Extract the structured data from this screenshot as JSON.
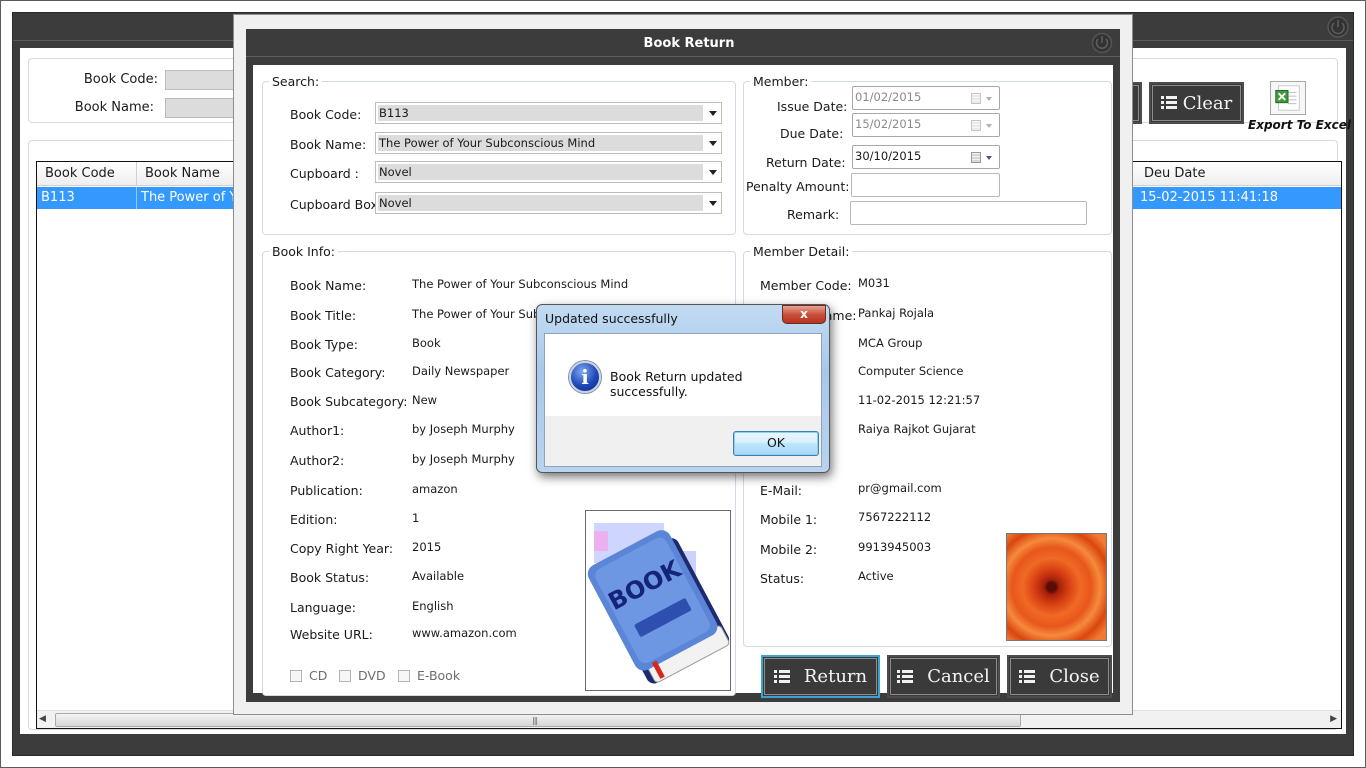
{
  "main_window": {
    "search": {
      "book_code_label": "Book Code:",
      "book_code_value": "",
      "book_name_label": "Book Name:",
      "book_name_value": ""
    },
    "clear_button": "Clear",
    "export_label": "Export To Excel",
    "grid": {
      "columns": [
        "Book Code",
        "Book Name",
        "Deu Date"
      ],
      "rows": [
        {
          "book_code": "B113",
          "book_name": "The Power of Yo",
          "due_date": "15-02-2015 11:41:18",
          "selected": true
        }
      ]
    }
  },
  "book_return": {
    "title": "Book Return",
    "search": {
      "legend": "Search:",
      "book_code_label": "Book Code:",
      "book_code": "B113",
      "book_name_label": "Book Name:",
      "book_name": "The Power of Your Subconscious Mind",
      "cupboard_label": "Cupboard :",
      "cupboard": "Novel",
      "cupboard_box_label": "Cupboard Box:",
      "cupboard_box": "Novel"
    },
    "member": {
      "legend": "Member:",
      "issue_date_label": "Issue Date:",
      "issue_date": "01/02/2015",
      "due_date_label": "Due Date:",
      "due_date": "15/02/2015",
      "return_date_label": "Return Date:",
      "return_date": "30/10/2015",
      "penalty_label": "Penalty Amount:",
      "penalty": "",
      "remark_label": "Remark:",
      "remark": ""
    },
    "book_info": {
      "legend": "Book Info:",
      "fields": [
        {
          "label": "Book Name:",
          "value": "The Power of Your Subconscious Mind"
        },
        {
          "label": "Book Title:",
          "value": "The Power of Your Subconscious Mind"
        },
        {
          "label": "Book Type:",
          "value": "Book"
        },
        {
          "label": "Book Category:",
          "value": "Daily Newspaper"
        },
        {
          "label": "Book Subcategory:",
          "value": "New"
        },
        {
          "label": "Author1:",
          "value": "by Joseph Murphy"
        },
        {
          "label": "Author2:",
          "value": "by Joseph Murphy"
        },
        {
          "label": "Publication:",
          "value": "amazon"
        },
        {
          "label": "Edition:",
          "value": "1"
        },
        {
          "label": "Copy Right Year:",
          "value": "2015"
        },
        {
          "label": "Book Status:",
          "value": "Available"
        },
        {
          "label": "Language:",
          "value": "English"
        },
        {
          "label": "Website URL:",
          "value": "www.amazon.com"
        }
      ],
      "media": [
        {
          "label": "CD",
          "checked": false
        },
        {
          "label": "DVD",
          "checked": false
        },
        {
          "label": "E-Book",
          "checked": false
        }
      ],
      "cover_text": "BOOK"
    },
    "member_detail": {
      "legend": "Member Detail:",
      "fields": [
        {
          "label": "Member Code:",
          "value": "M031"
        },
        {
          "label": "Member Name:",
          "value": "Pankaj Rojala"
        },
        {
          "label": "",
          "value": "MCA Group"
        },
        {
          "label": "",
          "value": "Computer Science"
        },
        {
          "label": "",
          "value": "11-02-2015 12:21:57"
        },
        {
          "label": "",
          "value": "Raiya Rajkot Gujarat"
        },
        {
          "label": "E-Mail:",
          "value": "pr@gmail.com"
        },
        {
          "label": "Mobile 1:",
          "value": "7567222112"
        },
        {
          "label": "Mobile 2:",
          "value": "9913945003"
        },
        {
          "label": "Status:",
          "value": "Active"
        }
      ]
    },
    "buttons": {
      "return": "Return",
      "cancel": "Cancel",
      "close": "Close"
    }
  },
  "message_box": {
    "title": "Updated successfully",
    "message": "Book Return updated successfully.",
    "ok": "OK",
    "close_glyph": "x"
  }
}
